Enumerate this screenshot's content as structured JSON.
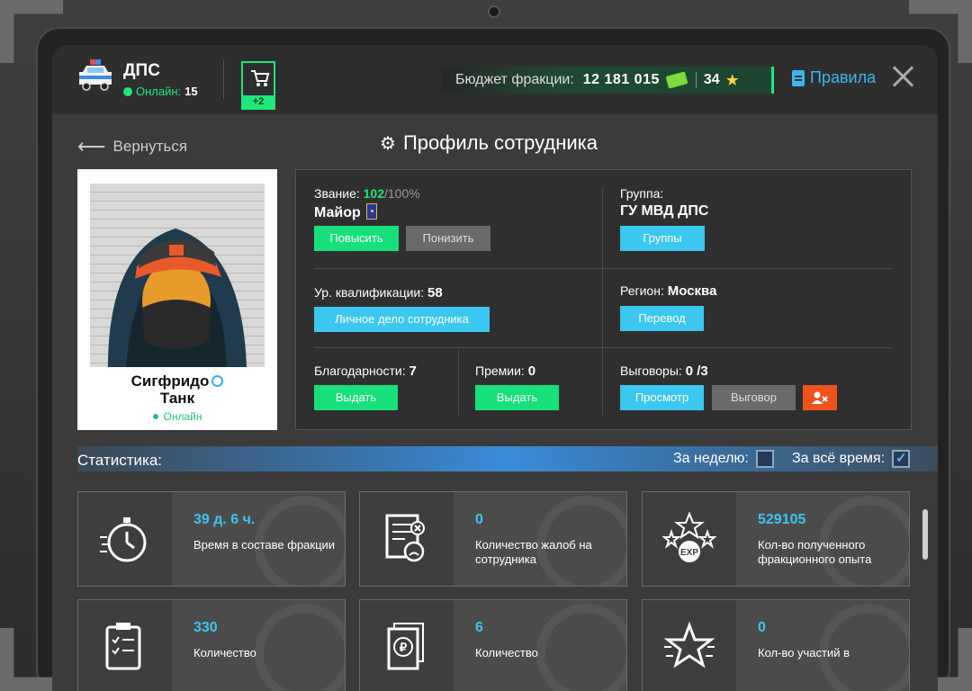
{
  "header": {
    "faction_name": "ДПС",
    "online_label": "Онлайн:",
    "online_count": "15",
    "cart_badge": "+2",
    "budget_label": "Бюджет фракции:",
    "budget_value": "12 181 015",
    "stars_value": "34",
    "rules_label": "Правила"
  },
  "nav": {
    "back_label": "Вернуться",
    "title": "Профиль сотрудника"
  },
  "profile": {
    "first_name": "Сигфридо",
    "last_name": "Танк",
    "status": "Онлайн"
  },
  "rank": {
    "label": "Звание:",
    "progress": "102",
    "progress_max": "/100%",
    "name": "Майор",
    "promote_button": "Повысить",
    "demote_button": "Понизить"
  },
  "group": {
    "label": "Группа:",
    "name": "ГУ МВД ДПС",
    "button": "Группы"
  },
  "qualification": {
    "label": "Ур. квалификации:",
    "value": "58",
    "button": "Личное дело сотрудника"
  },
  "region": {
    "label": "Регион:",
    "value": "Москва",
    "button": "Перевод"
  },
  "thanks": {
    "label": "Благодарности:",
    "value": "7",
    "button": "Выдать"
  },
  "bonuses": {
    "label": "Премии:",
    "value": "0",
    "button": "Выдать"
  },
  "reprimands": {
    "label": "Выговоры:",
    "value": "0 /3",
    "view_button": "Просмотр",
    "reprimand_button": "Выговор"
  },
  "stats": {
    "title": "Статистика:",
    "week_label": "За неделю:",
    "week_checked": false,
    "all_time_label": "За всё время:",
    "all_time_checked": true,
    "tiles": [
      {
        "value": "39 д. 6 ч.",
        "label": "Время в составе фракции",
        "icon": "stopwatch-icon"
      },
      {
        "value": "0",
        "label": "Количество жалоб на сотрудника",
        "icon": "complaint-icon"
      },
      {
        "value": "529105",
        "label": "Кол-во полученного фракционного опыта",
        "icon": "exp-icon"
      },
      {
        "value": "330",
        "label": "Количество",
        "icon": "clipboard-icon"
      },
      {
        "value": "6",
        "label": "Количество",
        "icon": "ruble-document-icon"
      },
      {
        "value": "0",
        "label": "Кол-во участий в",
        "icon": "star-icon"
      }
    ]
  },
  "colors": {
    "accent_green": "#1ee87a",
    "accent_blue": "#3cc7f0",
    "danger_red": "#f0521e"
  }
}
